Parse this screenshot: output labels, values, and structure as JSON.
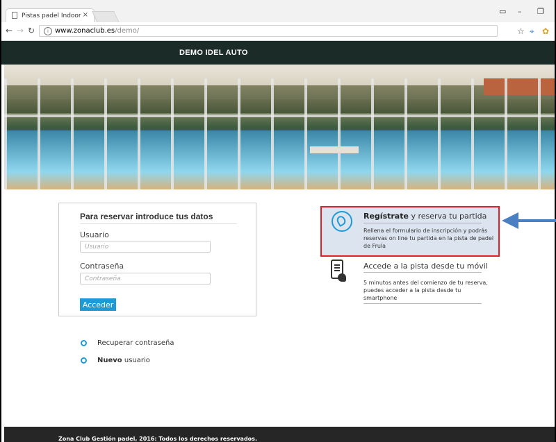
{
  "browser": {
    "tab_title": "Pistas padel Indoor",
    "tab_close": "×",
    "url_host": "www.zonaclub.es",
    "url_path": "/demo/",
    "minimize": "–",
    "restore": "❐"
  },
  "header": {
    "title": "DEMO IDEL AUTO"
  },
  "login": {
    "title": "Para reservar introduce tus datos",
    "user_label": "Usuario",
    "user_placeholder": "Usuario",
    "password_label": "Contraseña",
    "password_placeholder": "Contraseña",
    "submit_label": "Acceder"
  },
  "links": {
    "recover": "Recuperar contraseña",
    "new_bold": "Nuevo",
    "new_rest": " usuario"
  },
  "register": {
    "title_bold": "Regístrate",
    "title_rest": " y reserva tu partida",
    "description": "Rellena el formulario de inscripción y podrás reservas on line tu partida en la pista de padel de Frula"
  },
  "mobile": {
    "title": "Accede a la pista desde tu móvil",
    "description": "5 minutos antes del comienzo de tu reserva, puedes acceder a la pista desde tu smartphone"
  },
  "footer": {
    "text": "Zona Club Gestión padel, 2016: Todos los derechos reservados."
  },
  "colors": {
    "accent": "#1e9bd7",
    "highlight_border": "#e01f26",
    "arrow": "#4a7fc1",
    "header_bg": "#1b2b28"
  },
  "icons": [
    "page-icon",
    "back-icon",
    "forward-icon",
    "reload-icon",
    "info-icon",
    "star-icon",
    "extension-icon",
    "padel-icon",
    "phone-icon",
    "arrow-icon"
  ]
}
